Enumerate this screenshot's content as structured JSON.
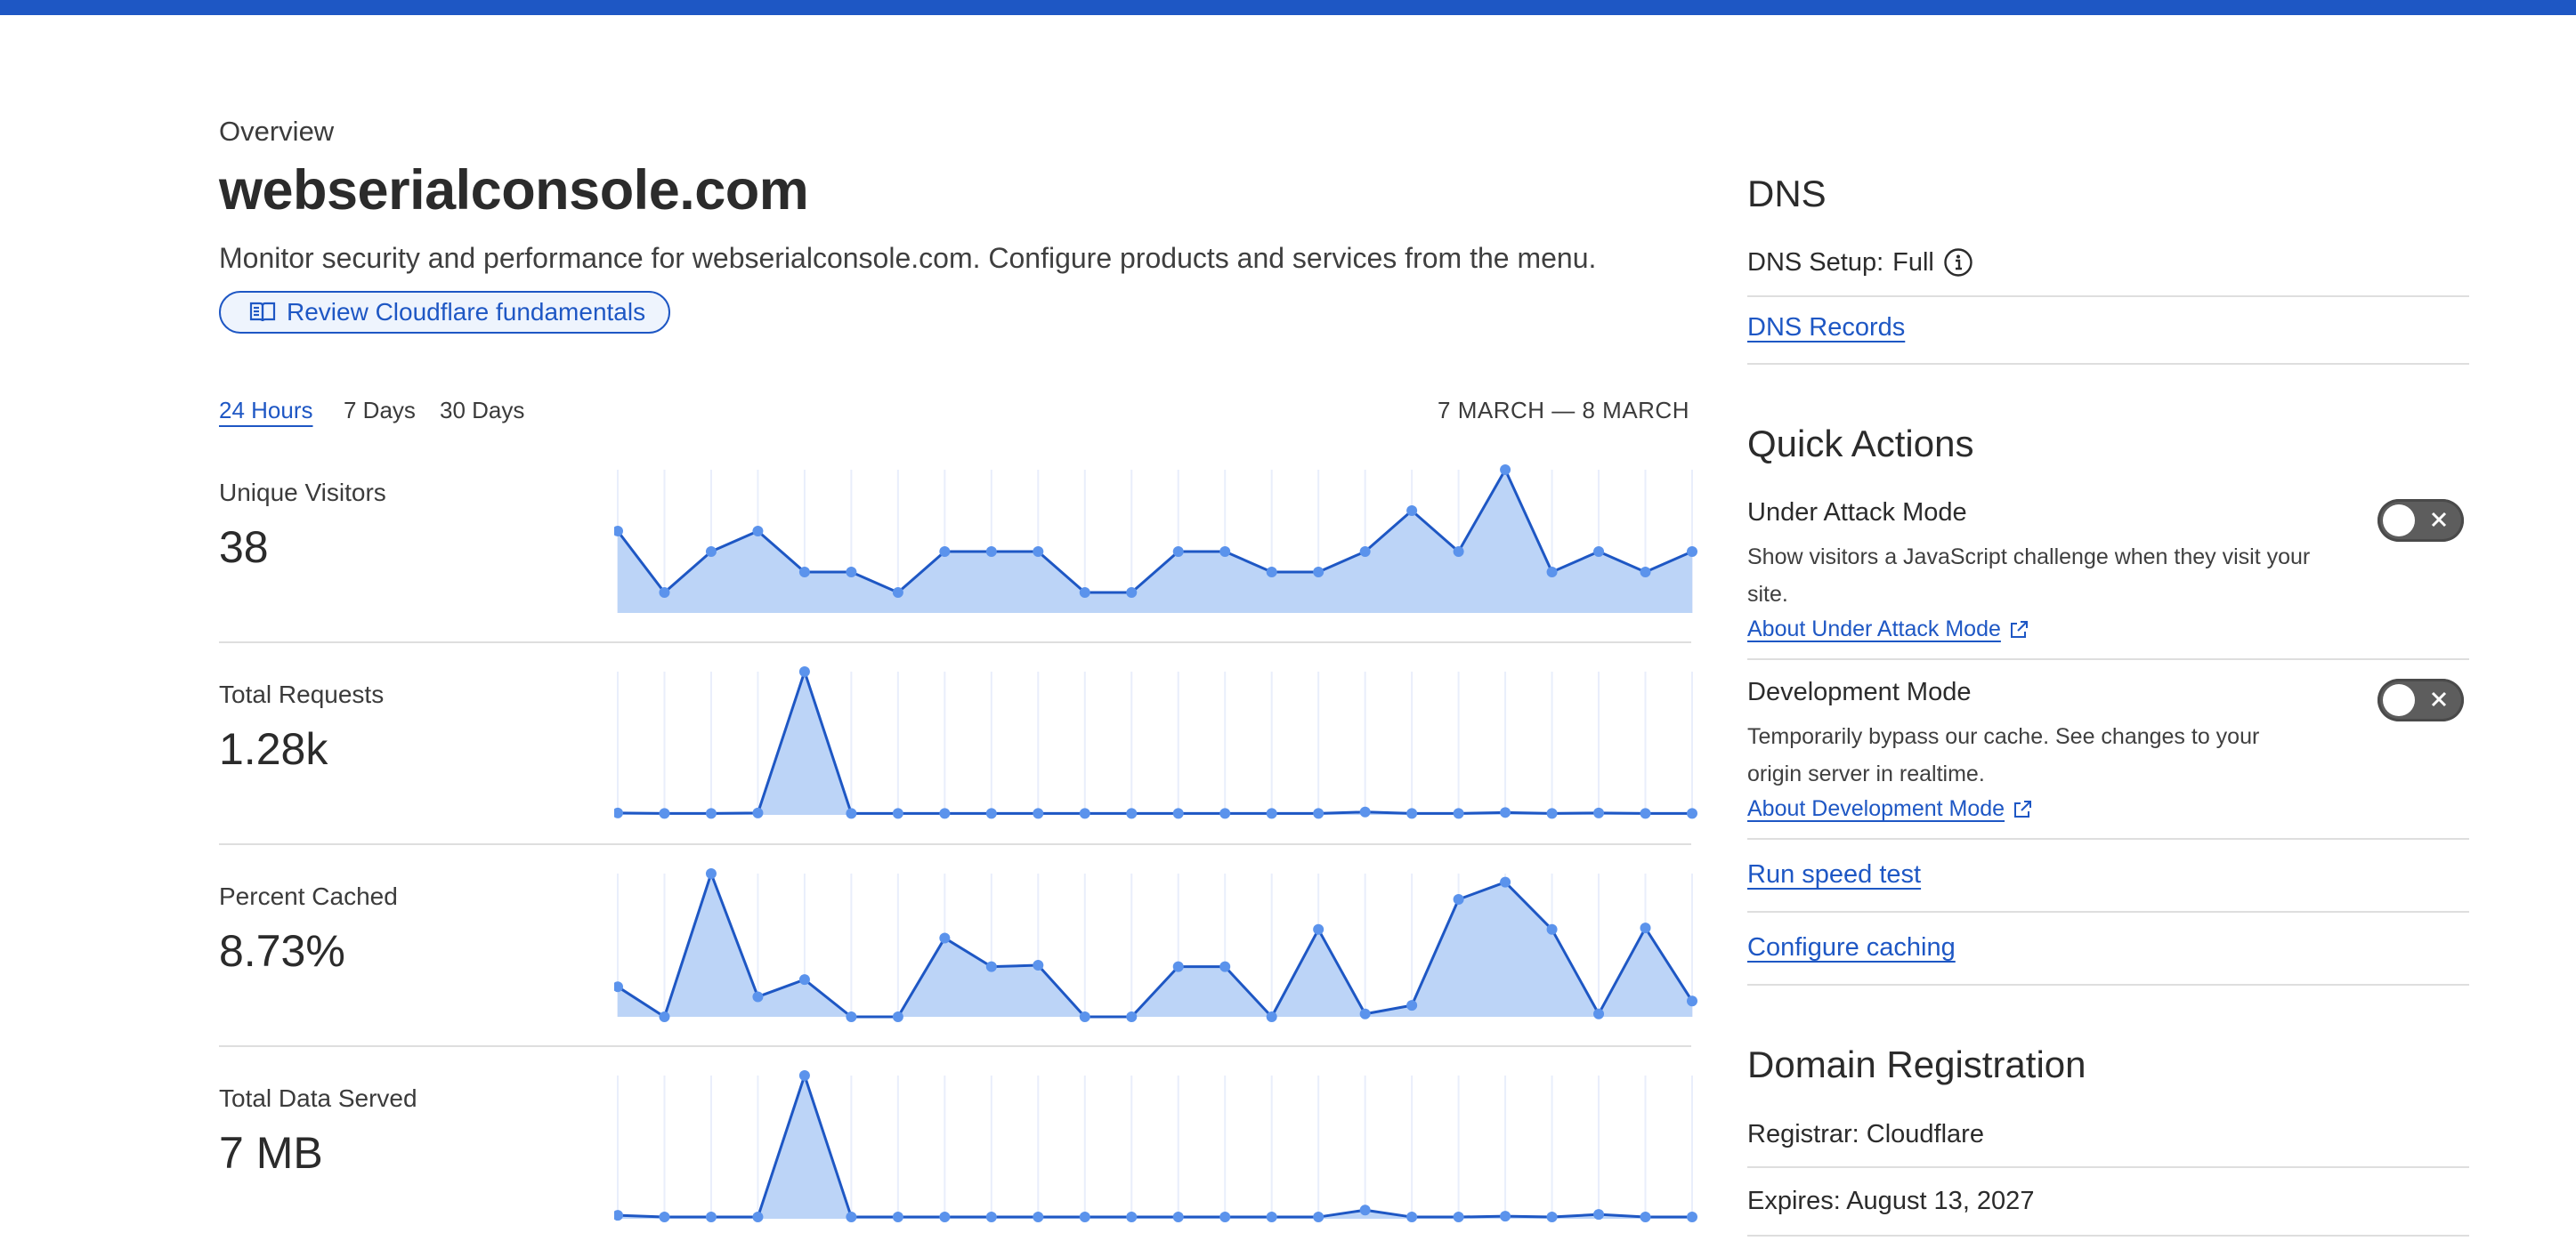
{
  "header": {
    "eyebrow": "Overview",
    "title": "webserialconsole.com",
    "description": "Monitor security and performance for webserialconsole.com. Configure products and services from the menu.",
    "review_button": "Review Cloudflare fundamentals"
  },
  "time_range": {
    "tabs": [
      "24 Hours",
      "7 Days",
      "30 Days"
    ],
    "active_tab": "24 Hours",
    "range_label": "7 MARCH — 8 MARCH"
  },
  "metrics": [
    {
      "label": "Unique Visitors",
      "value": "38"
    },
    {
      "label": "Total Requests",
      "value": "1.28k"
    },
    {
      "label": "Percent Cached",
      "value": "8.73%"
    },
    {
      "label": "Total Data Served",
      "value": "7 MB"
    }
  ],
  "chart_data": [
    {
      "type": "area",
      "series": [
        {
          "values": [
            4,
            1,
            3,
            4,
            2,
            2,
            1,
            3,
            3,
            3,
            1,
            1,
            3,
            3,
            2,
            2,
            3,
            5,
            3,
            7,
            2,
            3,
            2,
            3
          ]
        }
      ],
      "ylim": [
        0,
        7
      ]
    },
    {
      "type": "area",
      "series": [
        {
          "values": [
            4,
            3,
            3,
            4,
            300,
            3,
            3,
            3,
            3,
            3,
            3,
            3,
            3,
            3,
            3,
            3,
            6,
            3,
            3,
            5,
            3,
            4,
            3,
            3
          ]
        }
      ],
      "ylim": [
        0,
        300
      ]
    },
    {
      "type": "area",
      "series": [
        {
          "values": [
            21,
            0,
            100,
            14,
            26,
            0,
            0,
            55,
            35,
            36,
            0,
            0,
            35,
            35,
            0,
            61,
            2,
            8,
            82,
            94,
            61,
            2,
            62,
            11
          ]
        }
      ],
      "ylim": [
        0,
        100
      ]
    },
    {
      "type": "area",
      "series": [
        {
          "values": [
            0.08,
            0.04,
            0.04,
            0.04,
            3.3,
            0.04,
            0.04,
            0.04,
            0.04,
            0.04,
            0.04,
            0.04,
            0.04,
            0.04,
            0.04,
            0.04,
            0.2,
            0.04,
            0.04,
            0.06,
            0.04,
            0.1,
            0.04,
            0.04
          ]
        }
      ],
      "ylim": [
        0,
        3.3
      ]
    }
  ],
  "dns": {
    "heading": "DNS",
    "setup_label": "DNS Setup:",
    "setup_value": "Full",
    "records_link": "DNS Records"
  },
  "quick_actions": {
    "heading": "Quick Actions",
    "under_attack": {
      "title": "Under Attack Mode",
      "description": "Show visitors a JavaScript challenge when they visit your site.",
      "link": "About Under Attack Mode",
      "enabled": false
    },
    "development": {
      "title": "Development Mode",
      "description": "Temporarily bypass our cache. See changes to your origin server in realtime.",
      "link": "About Development Mode",
      "enabled": false
    },
    "speed_test": "Run speed test",
    "configure_caching": "Configure caching"
  },
  "domain_registration": {
    "heading": "Domain Registration",
    "registrar": "Registrar: Cloudflare",
    "expires": "Expires: August 13, 2027"
  },
  "colors": {
    "accent": "#1e57c4",
    "chart_line": "#1e57c4",
    "chart_fill": "#bcd4f7",
    "chart_point": "#5b93ec",
    "top_bar": "#1e57c4"
  },
  "icons": [
    "book-open-icon",
    "info-icon",
    "external-link-icon",
    "close-icon"
  ]
}
